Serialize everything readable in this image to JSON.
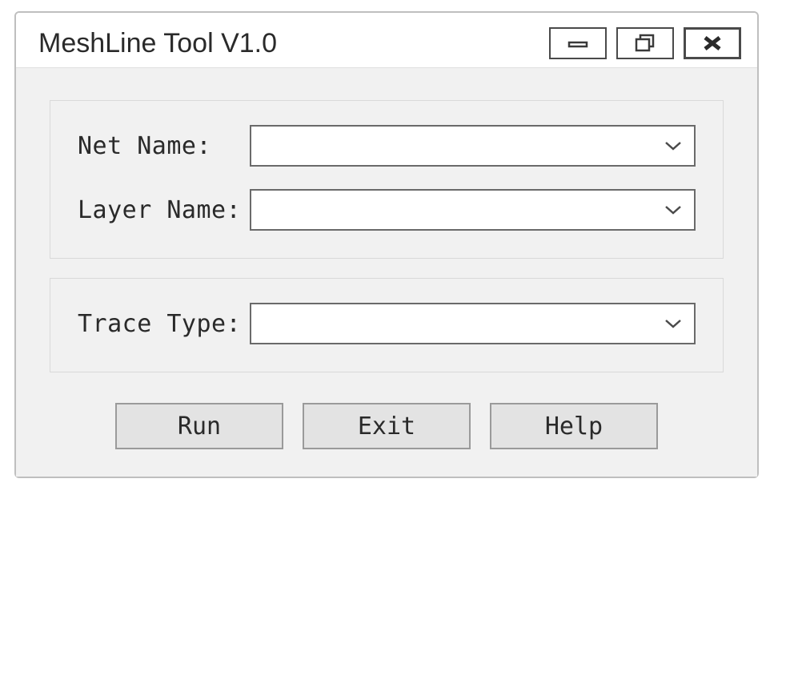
{
  "window": {
    "title": "MeshLine Tool V1.0"
  },
  "fields": {
    "net_name": {
      "label": "Net Name:",
      "value": ""
    },
    "layer_name": {
      "label": "Layer Name:",
      "value": ""
    },
    "trace_type": {
      "label": "Trace Type:",
      "value": ""
    }
  },
  "buttons": {
    "run": "Run",
    "exit": "Exit",
    "help": "Help"
  }
}
